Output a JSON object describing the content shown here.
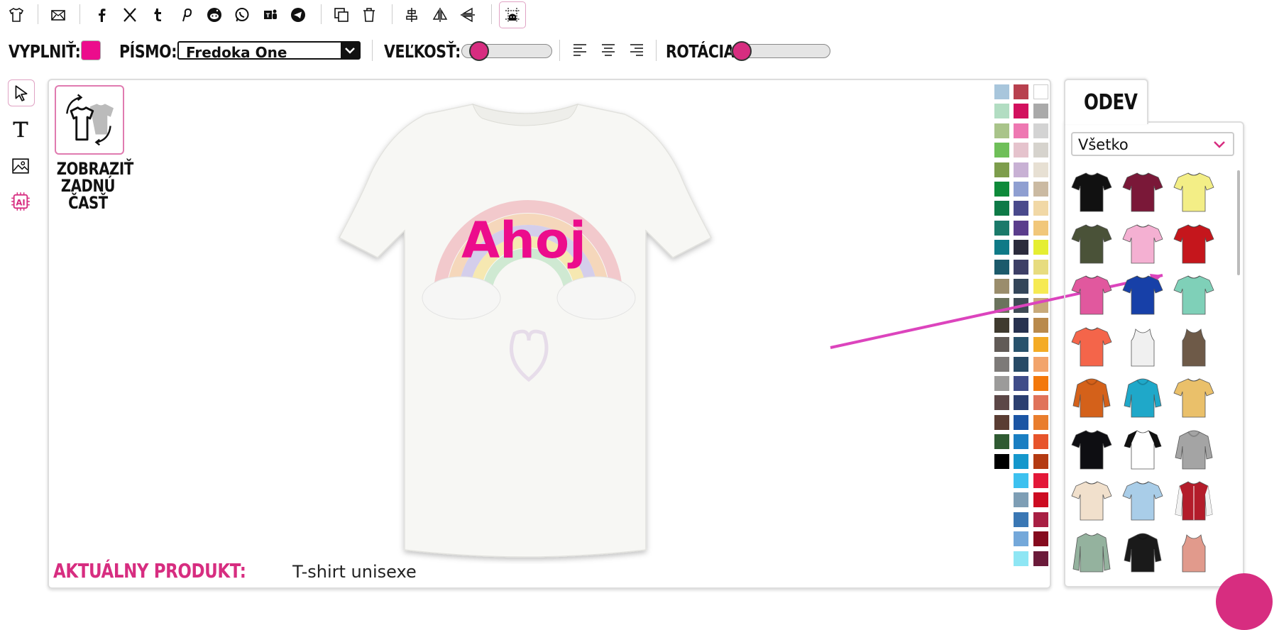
{
  "toolbar": {
    "icons": [
      "tshirt-icon",
      "email-icon",
      "facebook-icon",
      "x-twitter-icon",
      "tumblr-icon",
      "pinterest-icon",
      "reddit-icon",
      "whatsapp-icon",
      "teams-icon",
      "telegram-icon",
      "duplicate-icon",
      "trash-icon",
      "align-center-icon",
      "flip-horizontal-icon",
      "flip-vertical-icon",
      "guides-icon"
    ]
  },
  "props": {
    "fill_label": "VYPLNIŤ:",
    "fill_color": "#ec0c8c",
    "font_label": "PÍSMO:",
    "font_value": "Fredoka One",
    "size_label": "VEĽKOSŤ:",
    "size_level": 0.1,
    "rotation_label": "ROTÁCIA:",
    "rotation_level": 0.0
  },
  "left_tools": [
    "select-tool-icon",
    "text-tool-icon",
    "image-tool-icon",
    "ai-tool-icon"
  ],
  "canvas": {
    "back_view_label": [
      "ZOBRAZIŤ",
      "ZADNÚ",
      "ČASŤ"
    ],
    "design_text": "Ahoj",
    "product_key": "AKTUÁLNY PRODUKT:",
    "product_value": "T-shirt unisexe"
  },
  "palette": {
    "col1": [
      "#a8c6dc",
      "#b2ddc2",
      "#a9c48a",
      "#6fbf59",
      "#7d9d4c",
      "#0e8a3a",
      "#0e7a47",
      "#1b7a6a",
      "#0f7a87",
      "#1c5a6b",
      "#9a8d6c",
      "#6b735d",
      "#3f3a2f",
      "#615b57",
      "#7d7a78",
      "#9c9b9a",
      "#5c4747",
      "#5a3d33",
      "#2f5a32",
      "#000000"
    ],
    "col2": [
      "#b8404e",
      "#d2105e",
      "#ee78b2",
      "#e5c3cd",
      "#c8b1d4",
      "#8f9fd1",
      "#4a4a8c",
      "#5b3d8c",
      "#2b2b3c",
      "#3d3f66",
      "#34465a",
      "#3f4a55",
      "#27324f",
      "#28526c",
      "#274a66",
      "#3f4c89",
      "#2b3f70",
      "#1b55a4",
      "#1a7ec2",
      "#1597cc",
      "#3dc1ef",
      "#7e9eb5",
      "#3a77b4",
      "#74a8da",
      "#8ee6f4"
    ],
    "col3": [
      "#ffffff",
      "#a9a9a9",
      "#d3d3d3",
      "#d6d3cd",
      "#e7e0d3",
      "#cbbaa2",
      "#f1d8a6",
      "#f1c77a",
      "#e5ee32",
      "#e7dc7f",
      "#f6ea52",
      "#c8aa7a",
      "#b98a4c",
      "#f4ab25",
      "#f2a46b",
      "#f3780b",
      "#e0735a",
      "#e97d2d",
      "#e7542b",
      "#b43a12",
      "#e31838",
      "#cc0c22",
      "#a81f43",
      "#850b1e",
      "#6b1b3a"
    ]
  },
  "right_panel": {
    "tab_label": "ODEV",
    "category_value": "Všetko",
    "items": [
      {
        "name": "black-tshirt",
        "color": "#111111",
        "type": "tee"
      },
      {
        "name": "burgundy-tshirt",
        "color": "#7a1838",
        "type": "tee"
      },
      {
        "name": "yellow-tshirt",
        "color": "#f3ee86",
        "type": "tee"
      },
      {
        "name": "olive-tshirt",
        "color": "#4a5238",
        "type": "tee"
      },
      {
        "name": "pink-tshirt",
        "color": "#f4b0d2",
        "type": "tee"
      },
      {
        "name": "red-tshirt",
        "color": "#c5161c",
        "type": "tee"
      },
      {
        "name": "fuchsia-womens-tshirt",
        "color": "#e1589e",
        "type": "tee"
      },
      {
        "name": "royal-blue-tshirt",
        "color": "#1740a8",
        "type": "tee"
      },
      {
        "name": "mint-tshirt",
        "color": "#7fd0b8",
        "type": "tee"
      },
      {
        "name": "coral-tshirt",
        "color": "#f4654a",
        "type": "tee"
      },
      {
        "name": "white-tank-top",
        "color": "#f0f0f0",
        "type": "tank"
      },
      {
        "name": "brown-tank-top",
        "color": "#6e5a48",
        "type": "tank"
      },
      {
        "name": "orange-hoodie",
        "color": "#d4611a",
        "type": "hoodie"
      },
      {
        "name": "turquoise-hoodie",
        "color": "#1fa8c9",
        "type": "hoodie"
      },
      {
        "name": "tie-dye-tshirt",
        "color": "#eac06a",
        "type": "tee"
      },
      {
        "name": "black-tshirt-2",
        "color": "#0e0e12",
        "type": "tee"
      },
      {
        "name": "raglan-tshirt",
        "color": "#ffffff",
        "type": "raglan"
      },
      {
        "name": "grey-hoodie",
        "color": "#a4a4a4",
        "type": "hoodie"
      },
      {
        "name": "cream-tshirt",
        "color": "#f1e0cc",
        "type": "tee"
      },
      {
        "name": "dip-dye-tshirt",
        "color": "#a9cde8",
        "type": "tee"
      },
      {
        "name": "varsity-jacket",
        "color": "#b31c2a",
        "type": "jacket"
      },
      {
        "name": "sage-longsleeve",
        "color": "#94b29e",
        "type": "long"
      },
      {
        "name": "black-orange-hoodie",
        "color": "#1a1a1a",
        "type": "hoodie"
      },
      {
        "name": "rose-tank-top",
        "color": "#e19a8c",
        "type": "tank"
      }
    ]
  }
}
